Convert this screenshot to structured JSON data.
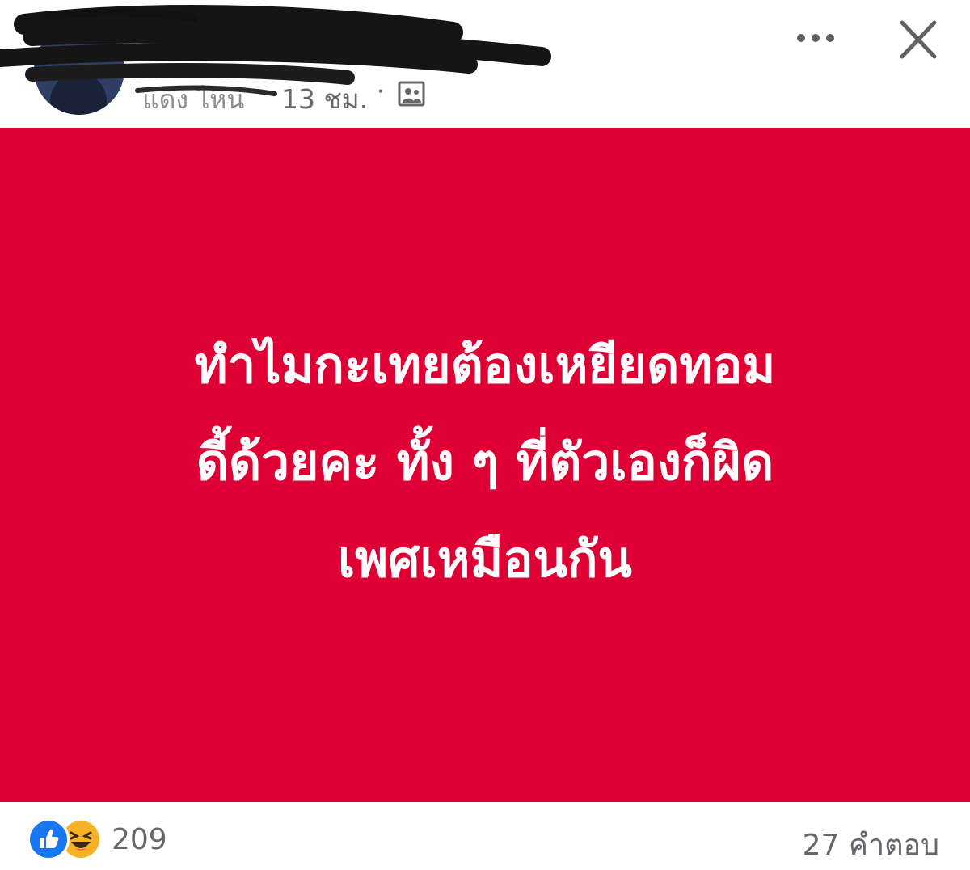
{
  "colors": {
    "post_background": "#de0034",
    "post_text": "#ffffff",
    "meta_text": "#65676b",
    "like_blue": "#1877f2",
    "haha_yellow": "#f7b125"
  },
  "header": {
    "author_name": "แดง ไหน",
    "time": "13 ชม.",
    "separator": "·",
    "audience_icon": "friends-icon",
    "more_icon": "more-horizontal-icon",
    "close_icon": "close-icon"
  },
  "post": {
    "lines": [
      "ทำไมกะเทยต้องเหยียดทอม",
      "ดี้ด้วยคะ ทั้ง ๆ ที่ตัวเองก็ผิด",
      "เพศเหมือนกัน"
    ]
  },
  "footer": {
    "reaction_icons": [
      "like-icon",
      "haha-icon"
    ],
    "reaction_count": "209",
    "comments": "27 คำตอบ"
  }
}
